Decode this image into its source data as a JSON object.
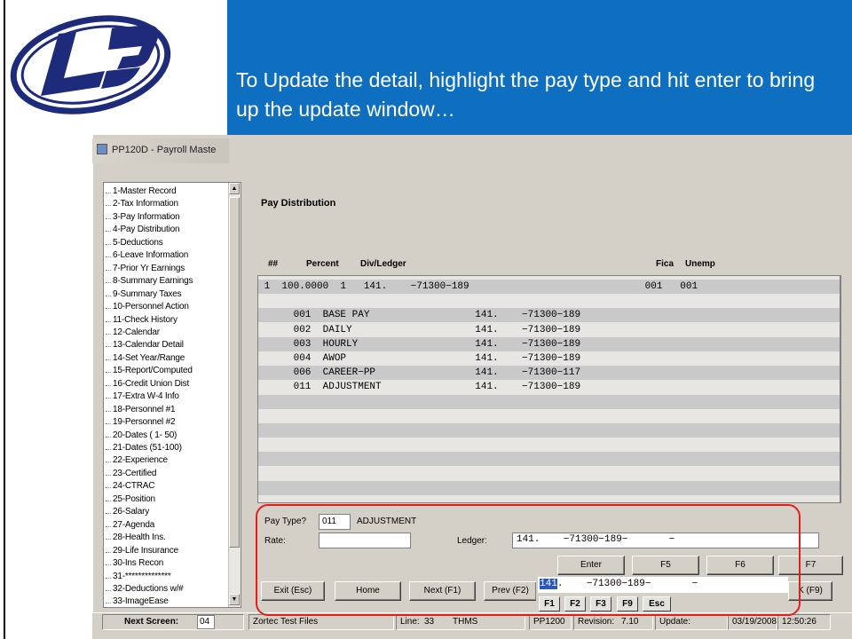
{
  "slide": {
    "callout_text": "To Update the detail, highlight the pay type and hit enter to bring up the update window…"
  },
  "window": {
    "title": "PP120D - Payroll Maste"
  },
  "nav": {
    "items": [
      "1-Master Record",
      "2-Tax Information",
      "3-Pay Information",
      "4-Pay Distribution",
      "5-Deductions",
      "6-Leave Information",
      "7-Prior Yr Earnings",
      "8-Summary Earnings",
      "9-Summary Taxes",
      "10-Personnel Action",
      "11-Check History",
      "12-Calendar",
      "13-Calendar Detail",
      "14-Set Year/Range",
      "15-Report/Computed",
      "16-Credit Union Dist",
      "17-Extra W-4 Info",
      "18-Personnel #1",
      "19-Personnel #2",
      "20-Dates ( 1- 50)",
      "21-Dates (51-100)",
      "22-Experience",
      "23-Certified",
      "24-CTRAC",
      "25-Position",
      "26-Salary",
      "27-Agenda",
      "28-Health Ins.",
      "29-Life Insurance",
      "30-Ins Recon",
      "31-**************",
      "32-Deductions w/#",
      "33-ImageEase"
    ]
  },
  "main": {
    "section_title": "Pay Distribution",
    "headers": {
      "num": "##",
      "percent": "Percent",
      "divledger": "Div/Ledger",
      "fica": "Fica",
      "unemp": "Unemp"
    },
    "rows": [
      " 1  100.0000  1   141.    −71300−189                              001   001",
      "",
      "      001  BASE PAY                  141.    −71300−189",
      "      002  DAILY                     141.    −71300−189",
      "      003  HOURLY                    141.    −71300−189",
      "      004  AWOP                      141.    −71300−189",
      "      006  CAREER−PP                 141.    −71300−117",
      "      011  ADJUSTMENT                141.    −71300−189",
      "",
      "",
      "",
      "",
      "",
      "",
      "",
      ""
    ]
  },
  "form": {
    "pay_type_label": "Pay Type?",
    "pay_type_value": "011",
    "pay_type_desc": "ADJUSTMENT",
    "rate_label": "Rate:",
    "rate_value": "",
    "ledger_label": "Ledger:",
    "ledger_value": "141.    −71300−189−       −"
  },
  "buttons": {
    "enter": "Enter",
    "f5": "F5",
    "f6": "F6",
    "f7": "F7",
    "exit": "Exit (Esc)",
    "home": "Home",
    "next": "Next (F1)",
    "prev": "Prev (F2)",
    "ok": "K (F9)"
  },
  "popup": {
    "value_selected": "141",
    "value_rest": ".    −71300−189−       −",
    "buttons": [
      "F1",
      "F2",
      "F3",
      "F9",
      "Esc"
    ]
  },
  "status": {
    "next_screen_label": "Next Screen:",
    "next_screen_value": "04",
    "company": "Zortec Test Files",
    "line_label": "Line:",
    "line_value": "33",
    "user": "THMS",
    "program": "PP1200",
    "revision_label": "Revision:",
    "revision_value": "7.10",
    "update_label": "Update:",
    "date": "03/19/2008",
    "time": "12:50:26"
  },
  "colors": {
    "callout_bg": "#0e6fc0",
    "highlight_ring": "#e02020",
    "row_shade": "#c9c9c9",
    "selection": "#2a57b8"
  }
}
